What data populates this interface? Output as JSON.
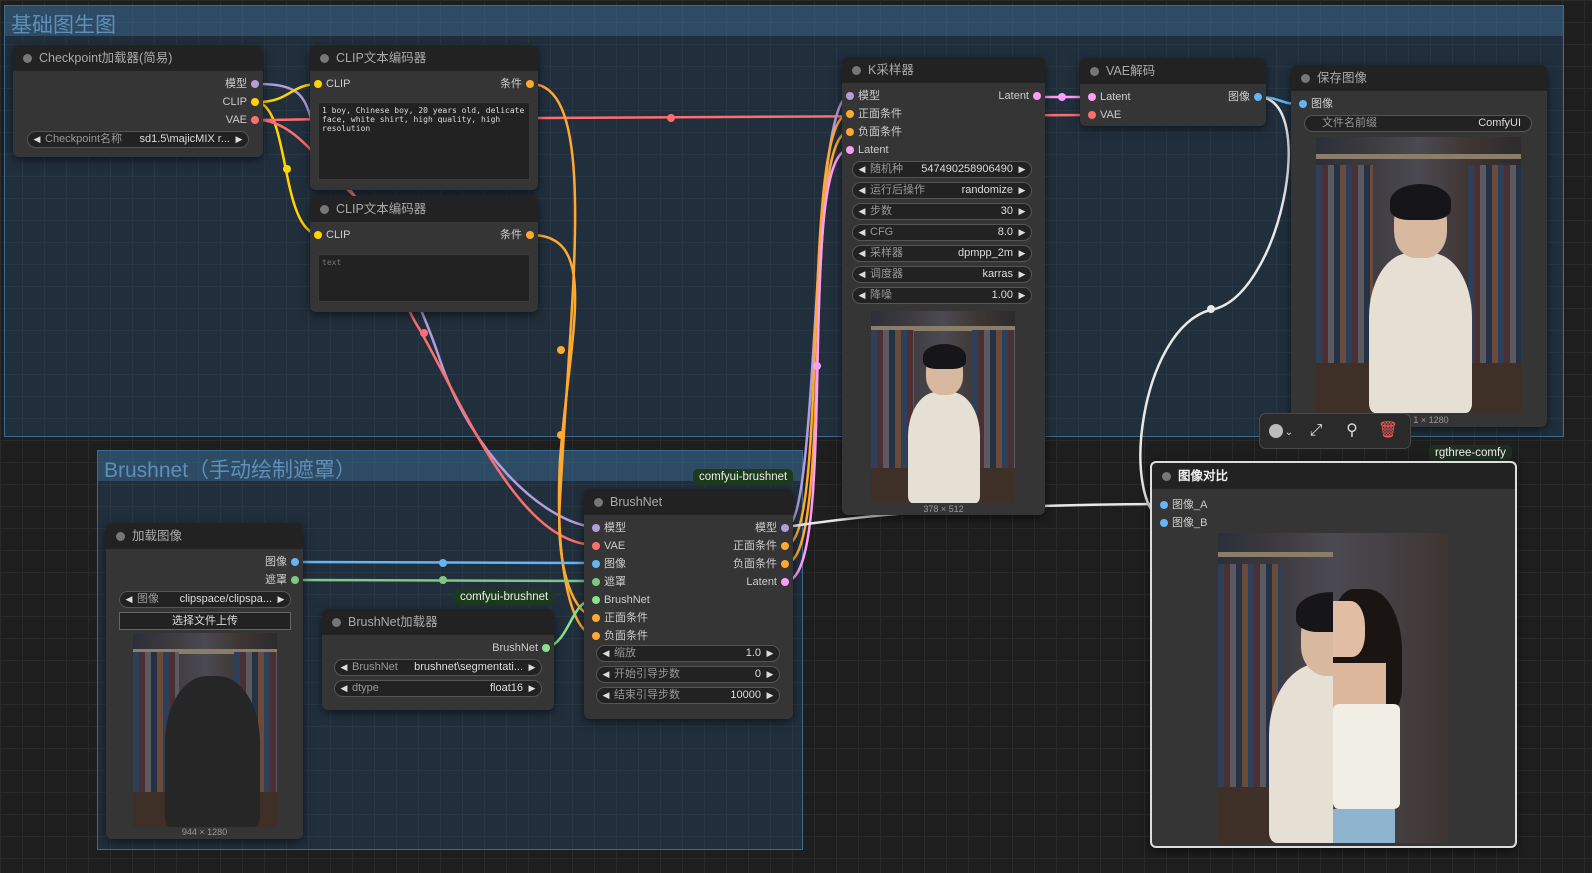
{
  "groups": {
    "basic": "基础图生图",
    "brushnet": "Brushnet（手动绘制遮罩）"
  },
  "badges": {
    "brushnet_node": "comfyui-brushnet",
    "brushnet_loader": "comfyui-brushnet",
    "compare": "rgthree-comfy"
  },
  "checkpoint": {
    "title": "Checkpoint加载器(简易)",
    "outputs": [
      "模型",
      "CLIP",
      "VAE"
    ],
    "ckpt_label": "Checkpoint名称",
    "ckpt_value": "sd1.5\\majicMIX r..."
  },
  "clip_pos": {
    "title": "CLIP文本编码器",
    "input": "CLIP",
    "output": "条件",
    "text": "1 boy, Chinese boy, 20 years old, delicate face, white shirt, high quality, high resolution"
  },
  "clip_neg": {
    "title": "CLIP文本编码器",
    "input": "CLIP",
    "output": "条件",
    "placeholder": "text"
  },
  "ksampler": {
    "title": "K采样器",
    "inputs": [
      "模型",
      "正面条件",
      "负面条件",
      "Latent"
    ],
    "output": "Latent",
    "widgets": [
      {
        "label": "随机种",
        "value": "547490258906490"
      },
      {
        "label": "运行后操作",
        "value": "randomize"
      },
      {
        "label": "步数",
        "value": "30"
      },
      {
        "label": "CFG",
        "value": "8.0"
      },
      {
        "label": "采样器",
        "value": "dpmpp_2m"
      },
      {
        "label": "调度器",
        "value": "karras"
      },
      {
        "label": "降噪",
        "value": "1.00"
      }
    ],
    "size": "378 × 512"
  },
  "vae_decode": {
    "title": "VAE解码",
    "inputs": [
      "Latent",
      "VAE"
    ],
    "output": "图像"
  },
  "save_image": {
    "title": "保存图像",
    "input": "图像",
    "prefix_label": "文件名前缀",
    "prefix_value": "ComfyUI",
    "size": "1 × 1280"
  },
  "load_image": {
    "title": "加载图像",
    "outputs": [
      "图像",
      "遮罩"
    ],
    "image_label": "图像",
    "image_value": "clipspace/clipspa...",
    "upload": "选择文件上传",
    "size": "944 × 1280"
  },
  "brushnet": {
    "title": "BrushNet",
    "inputs": [
      "模型",
      "VAE",
      "图像",
      "遮罩",
      "BrushNet",
      "正面条件",
      "负面条件"
    ],
    "outputs": [
      "模型",
      "正面条件",
      "负面条件",
      "Latent"
    ],
    "widgets": [
      {
        "label": "缩放",
        "value": "1.0"
      },
      {
        "label": "开始引导步数",
        "value": "0"
      },
      {
        "label": "结束引导步数",
        "value": "10000"
      }
    ]
  },
  "brushnet_loader": {
    "title": "BrushNet加载器",
    "output": "BrushNet",
    "widgets": [
      {
        "label": "BrushNet",
        "value": "brushnet\\segmentati..."
      },
      {
        "label": "dtype",
        "value": "float16"
      }
    ]
  },
  "image_compare": {
    "title": "图像对比",
    "inputs": [
      "图像_A",
      "图像_B"
    ]
  },
  "colors": {
    "model": "#b39ddb",
    "clip": "#ffd500",
    "vae": "#ff6e6e",
    "conditioning": "#ffa931",
    "latent": "#ff9cf9",
    "image": "#64b5f6",
    "mask": "#81c784",
    "brushnet": "#8be28b",
    "group": "#3b6b8f"
  },
  "icons": {
    "color": "color-circle-icon",
    "pin_link": "link-icon",
    "pin": "pin-icon",
    "delete": "trash-icon"
  }
}
